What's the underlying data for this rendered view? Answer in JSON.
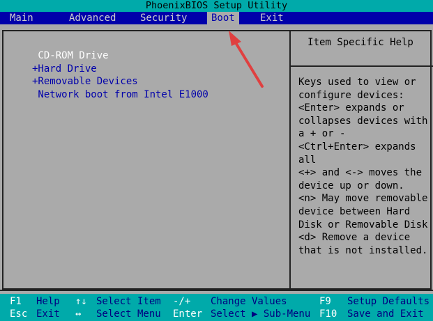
{
  "title": "PhoenixBIOS Setup Utility",
  "menu": {
    "tabs": [
      {
        "label": "Main"
      },
      {
        "label": "Advanced"
      },
      {
        "label": "Security"
      },
      {
        "label": "Boot",
        "selected": true
      },
      {
        "label": "Exit"
      }
    ]
  },
  "boot": {
    "items": [
      {
        "label": " CD-ROM Drive",
        "selected": true
      },
      {
        "label": "+Hard Drive"
      },
      {
        "label": "+Removable Devices"
      },
      {
        "label": " Network boot from Intel E1000"
      }
    ]
  },
  "help": {
    "header": "Item Specific Help",
    "lines": [
      "Keys used to view or",
      "configure devices:",
      "<Enter> expands or",
      "collapses devices with",
      "a + or -",
      "<Ctrl+Enter> expands",
      "all",
      "<+> and <-> moves the",
      "device up or down.",
      "<n> May move removable",
      "device between Hard",
      "Disk or Removable Disk",
      "<d> Remove a device",
      "that is not installed."
    ]
  },
  "footer": {
    "rows": [
      [
        {
          "key": "F1",
          "desc": "Help"
        },
        {
          "key": "↑↓",
          "desc": "Select Item"
        },
        {
          "key": "-/+",
          "desc": "Change Values"
        },
        {
          "key": "F9",
          "desc": "Setup Defaults"
        }
      ],
      [
        {
          "key": "Esc",
          "desc": "Exit"
        },
        {
          "key": "↔",
          "desc": "Select Menu"
        },
        {
          "key": "Enter",
          "desc": "Select ▶ Sub-Menu"
        },
        {
          "key": "F10",
          "desc": "Save and Exit"
        }
      ]
    ]
  },
  "colors": {
    "title_bg": "#00aaaa",
    "menu_bg": "#0000aa",
    "panel_bg": "#aaaaaa",
    "annotation_arrow": "#e04040"
  }
}
